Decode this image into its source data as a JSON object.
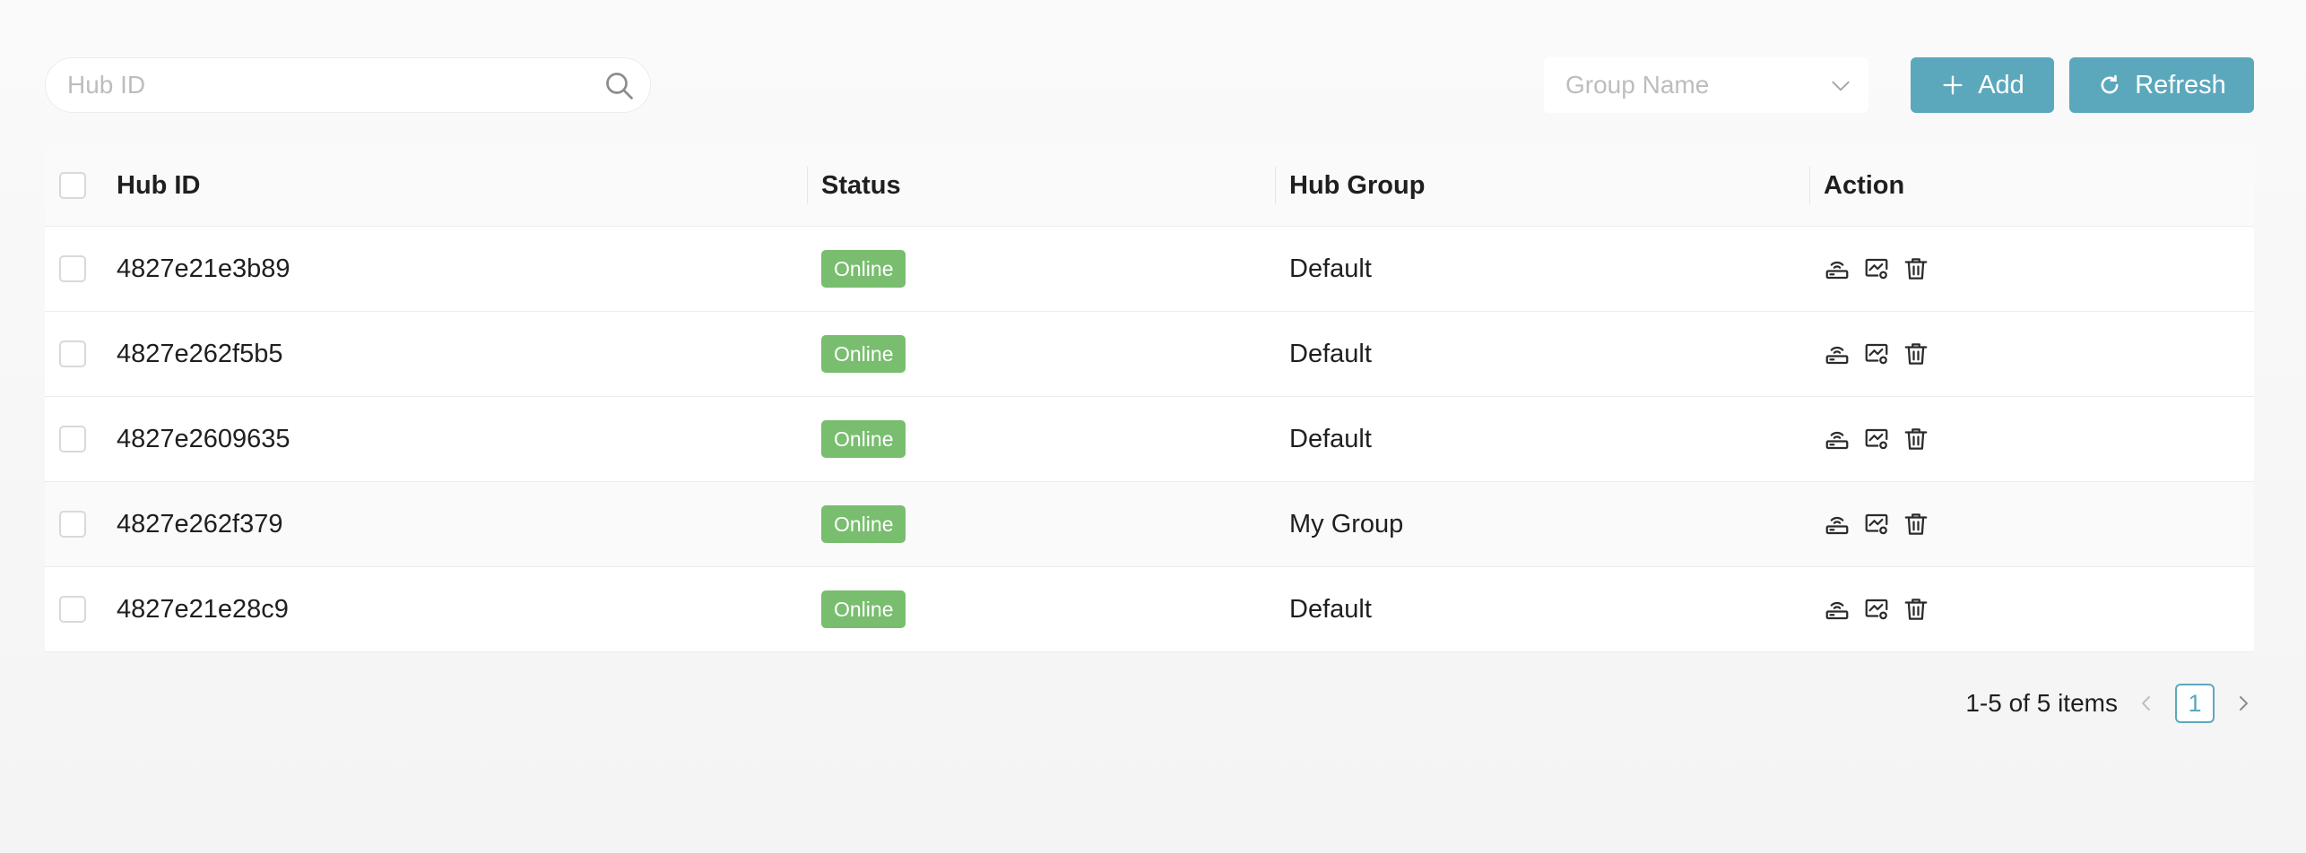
{
  "toolbar": {
    "search_placeholder": "Hub ID",
    "group_select_placeholder": "Group Name",
    "add_label": "Add",
    "refresh_label": "Refresh",
    "accent_color": "#5ba8bd"
  },
  "table": {
    "columns": [
      "Hub ID",
      "Status",
      "Hub Group",
      "Action"
    ],
    "rows": [
      {
        "hub_id": "4827e21e3b89",
        "status": "Online",
        "group": "Default"
      },
      {
        "hub_id": "4827e262f5b5",
        "status": "Online",
        "group": "Default"
      },
      {
        "hub_id": "4827e2609635",
        "status": "Online",
        "group": "Default"
      },
      {
        "hub_id": "4827e262f379",
        "status": "Online",
        "group": "My Group"
      },
      {
        "hub_id": "4827e21e28c9",
        "status": "Online",
        "group": "Default"
      }
    ],
    "status_color": "#79bd6f",
    "action_icons": [
      "hub-signal-icon",
      "monitor-settings-icon",
      "trash-icon"
    ]
  },
  "pagination": {
    "summary": "1-5 of 5 items",
    "current_page": "1"
  }
}
